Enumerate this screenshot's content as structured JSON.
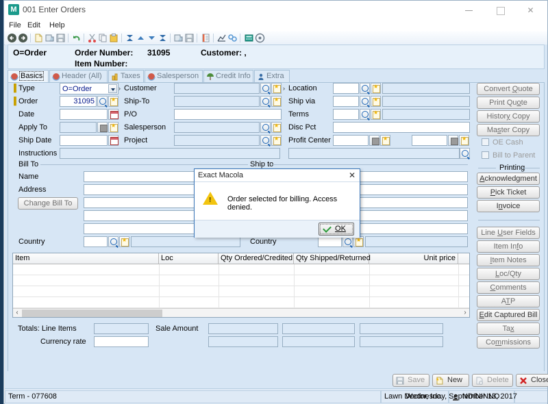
{
  "window": {
    "title": "001 Enter Orders",
    "icon": "M",
    "minimize": "minimize-icon",
    "maximize": "maximize-icon",
    "close": "close-icon"
  },
  "menu": [
    "File",
    "Edit",
    "Help"
  ],
  "toolbar_icons": [
    "back-icon",
    "forward-icon",
    "new-document-icon",
    "save-as-icon",
    "save-icon",
    "undo-icon",
    "cut-icon",
    "copy-icon",
    "paste-icon",
    "first-record-icon",
    "previous-record-icon",
    "next-record-icon",
    "last-record-icon",
    "export-icon",
    "save-record-icon",
    "notes-icon",
    "chart-icon",
    "link-icon",
    "calculator-icon",
    "help-icon"
  ],
  "header": {
    "type": "O=Order",
    "order_number_label": "Order Number:",
    "order_number": "31095",
    "customer_label": "Customer: ,",
    "item_number_label": "Item Number:"
  },
  "tabs": [
    {
      "label": "Basics",
      "icon": "sphere-icon",
      "active": true
    },
    {
      "label": "Header (All)",
      "icon": "sphere-icon",
      "active": false
    },
    {
      "label": "Taxes",
      "icon": "coins-icon",
      "active": false
    },
    {
      "label": "Salesperson",
      "icon": "sphere-icon",
      "active": false
    },
    {
      "label": "Credit Info",
      "icon": "umbrella-icon",
      "active": false
    },
    {
      "label": "Extra",
      "icon": "person-icon",
      "active": false
    }
  ],
  "form": {
    "col1": [
      {
        "label": "Type",
        "value": "O=Order",
        "required": true,
        "widget": "combo"
      },
      {
        "label": "Order",
        "value": "31095",
        "required": true,
        "widget": "lookup"
      },
      {
        "label": "Date",
        "value": "",
        "widget": "calendar"
      },
      {
        "label": "Apply To",
        "value": "",
        "widget": "square-lookup"
      },
      {
        "label": "Ship Date",
        "value": "",
        "widget": "calendar"
      },
      {
        "label": "Instructions",
        "value": "",
        "widget": "wide"
      }
    ],
    "col2": [
      {
        "label": "Customer",
        "value": "",
        "widget": "lookup",
        "marker": true
      },
      {
        "label": "Ship-To",
        "value": "",
        "widget": "lookup"
      },
      {
        "label": "P/O",
        "value": "",
        "widget": "plain"
      },
      {
        "label": "Salesperson",
        "value": "",
        "widget": "lookup"
      },
      {
        "label": "Project",
        "value": "",
        "widget": "lookup"
      }
    ],
    "col3": [
      {
        "label": "Location",
        "value": "",
        "widget": "lookup-wide",
        "marker": true
      },
      {
        "label": "Ship via",
        "value": "",
        "widget": "lookup-wide"
      },
      {
        "label": "Terms",
        "value": "",
        "widget": "lookup-wide"
      },
      {
        "label": "Disc Pct",
        "value": "",
        "widget": "plain"
      },
      {
        "label": "Profit Center",
        "value": "",
        "widget": "dual"
      }
    ],
    "bill_to": {
      "group": "Bill To",
      "name_label": "Name",
      "address_label": "Address",
      "change_button": "Change Bill To",
      "country_label": "Country",
      "values": [
        "",
        "",
        "",
        "",
        ""
      ],
      "country_value": ""
    },
    "ship_to": {
      "group": "Ship to",
      "country_label": "Country",
      "values": [
        "",
        "",
        "",
        "",
        ""
      ],
      "country_value": ""
    }
  },
  "side_buttons": {
    "top": [
      {
        "label": "Convert Quote",
        "accel": "Q"
      },
      {
        "label": "Print Quote",
        "accel": "o"
      },
      {
        "label": "History Copy",
        "accel": "y"
      },
      {
        "label": "Master Copy",
        "accel": "s"
      }
    ],
    "checkboxes": [
      {
        "label": "OE Cash",
        "checked": false
      },
      {
        "label": "Bill to Parent",
        "checked": false
      }
    ],
    "printing_group": "Printing",
    "printing": [
      {
        "label": "Acknowledgment",
        "accel": "A"
      },
      {
        "label": "Pick Ticket",
        "accel": "P"
      },
      {
        "label": "Invoice",
        "accel": "n"
      }
    ],
    "bottom": [
      {
        "label": "Line User Fields",
        "accel": "U"
      },
      {
        "label": "Item Info",
        "accel": "f"
      },
      {
        "label": "Item Notes",
        "accel": "I"
      },
      {
        "label": "Loc/Qty",
        "accel": "L"
      },
      {
        "label": "Comments",
        "accel": "C"
      },
      {
        "label": "ATP",
        "accel": "T"
      },
      {
        "label": "Edit Captured Bill",
        "accel": "E"
      },
      {
        "label": "Tax",
        "accel": "x"
      },
      {
        "label": "Commissions",
        "accel": "m"
      }
    ]
  },
  "grid": {
    "columns": [
      {
        "label": "Item",
        "align": "left"
      },
      {
        "label": "Loc",
        "align": "left"
      },
      {
        "label": "Qty Ordered/Credited",
        "align": "right"
      },
      {
        "label": "Qty Shipped/Returned",
        "align": "right"
      },
      {
        "label": "Unit price",
        "align": "right"
      }
    ],
    "rows": [],
    "empty_row_count": 5,
    "scroll_left_icon": "scroll-left-icon",
    "scroll_right_icon": "scroll-right-icon"
  },
  "totals": {
    "line_items_label": "Totals: Line Items",
    "line_items_value": "",
    "currency_rate_label": "Currency rate",
    "currency_rate_value": "",
    "sale_amount_label": "Sale Amount",
    "amount_values": [
      "",
      "",
      "",
      "",
      "",
      ""
    ]
  },
  "bottom_buttons": [
    {
      "label": "Save",
      "icon": "save-icon",
      "disabled": true
    },
    {
      "label": "New",
      "icon": "new-icon",
      "disabled": false
    },
    {
      "label": "Delete",
      "icon": "delete-icon",
      "disabled": true
    },
    {
      "label": "Close",
      "icon": "close-x-icon",
      "disabled": false
    }
  ],
  "status_bar": {
    "terminal": "Term - 077608",
    "company": "Lawn Doctor, Inc.",
    "user": "NDININNO",
    "user_icon": "user-icon",
    "date": "Wednesday, September 13, 2017"
  },
  "dialog": {
    "title": "Exact Macola",
    "close_icon": "close-icon",
    "warning_icon": "warning-icon",
    "message": "Order selected for billing. Access denied.",
    "ok_label": "OK",
    "ok_accel": "O"
  },
  "colors": {
    "desktop": "#1b3c5c",
    "client_bg": "#d7e6f5",
    "field_text": "#00158a",
    "dialog_border": "#3a76b8",
    "warning": "#f2c40f",
    "tab_active_bg": "#eaf3fb"
  }
}
